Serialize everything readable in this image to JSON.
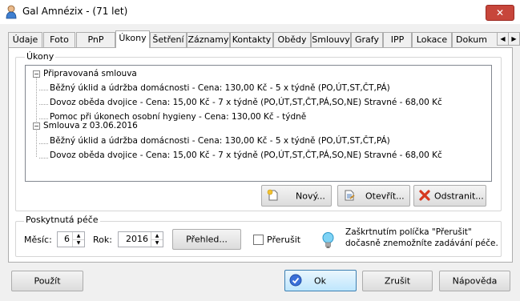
{
  "window": {
    "title": "Gal Amnézix - (71 let)",
    "close_glyph": "✕"
  },
  "tabs": [
    "Údaje",
    "Foto",
    "PnP",
    "Úkony",
    "Šetření",
    "Záznamy",
    "Kontakty",
    "Obědy",
    "Smlouvy",
    "Grafy",
    "IPP",
    "Lokace",
    "Dokum"
  ],
  "active_tab": "Úkony",
  "ukony": {
    "group_label": "Úkony",
    "tree": [
      {
        "label": "Připravovaná smlouva",
        "expander": "−",
        "children": [
          "Běžný úklid a údržba domácnosti - Cena: 130,00 Kč - 5 x týdně (PO,ÚT,ST,ČT,PÁ)",
          "Dovoz oběda dvojice - Cena: 15,00 Kč - 7 x týdně (PO,ÚT,ST,ČT,PÁ,SO,NE) Stravné - 68,00 Kč",
          "Pomoc při úkonech osobní hygieny - Cena: 130,00 Kč - týdně"
        ]
      },
      {
        "label": "Smlouva z 03.06.2016",
        "expander": "−",
        "children": [
          "Běžný úklid a údržba domácnosti - Cena: 130,00 Kč - 5 x týdně (PO,ÚT,ST,ČT,PÁ)",
          "Dovoz oběda dvojice - Cena: 15,00 Kč - 7 x týdně (PO,ÚT,ST,ČT,PÁ,SO,NE) Stravné - 68,00 Kč"
        ]
      }
    ],
    "buttons": {
      "new": "Nový...",
      "open": "Otevřít...",
      "delete": "Odstranit..."
    }
  },
  "care": {
    "group_label": "Poskytnutá péče",
    "month_label": "Měsíc:",
    "month_value": "6",
    "year_label": "Rok:",
    "year_value": "2016",
    "overview_button": "Přehled...",
    "interrupt_label": "Přerušit",
    "interrupt_checked": false,
    "hint_line1": "Zaškrtnutím políčka \"Přerušit\"",
    "hint_line2": "dočasně znemožníte zadávání péče."
  },
  "footer": {
    "apply": "Použít",
    "ok": "Ok",
    "cancel": "Zrušit",
    "help": "Nápověda"
  }
}
